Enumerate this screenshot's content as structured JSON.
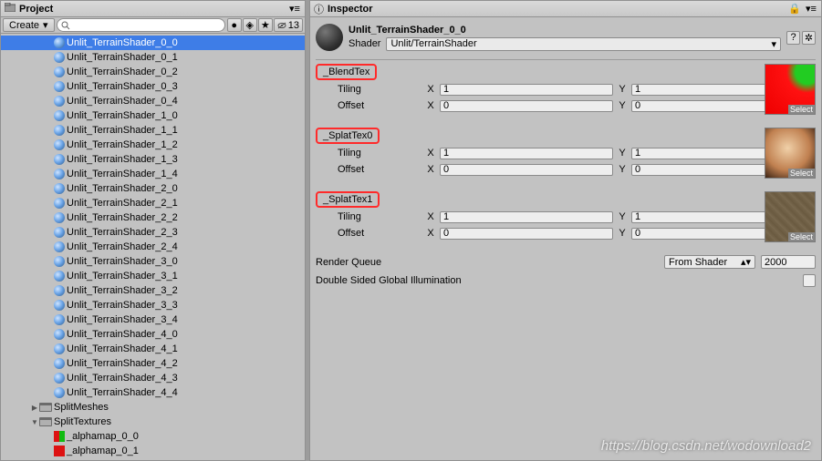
{
  "project": {
    "title": "Project",
    "create_label": "Create",
    "search_placeholder": "",
    "hidden_count": "13",
    "items": [
      {
        "type": "material",
        "name": "Unlit_TerrainShader_0_0",
        "depth": 3,
        "selected": true
      },
      {
        "type": "material",
        "name": "Unlit_TerrainShader_0_1",
        "depth": 3
      },
      {
        "type": "material",
        "name": "Unlit_TerrainShader_0_2",
        "depth": 3
      },
      {
        "type": "material",
        "name": "Unlit_TerrainShader_0_3",
        "depth": 3
      },
      {
        "type": "material",
        "name": "Unlit_TerrainShader_0_4",
        "depth": 3
      },
      {
        "type": "material",
        "name": "Unlit_TerrainShader_1_0",
        "depth": 3
      },
      {
        "type": "material",
        "name": "Unlit_TerrainShader_1_1",
        "depth": 3
      },
      {
        "type": "material",
        "name": "Unlit_TerrainShader_1_2",
        "depth": 3
      },
      {
        "type": "material",
        "name": "Unlit_TerrainShader_1_3",
        "depth": 3
      },
      {
        "type": "material",
        "name": "Unlit_TerrainShader_1_4",
        "depth": 3
      },
      {
        "type": "material",
        "name": "Unlit_TerrainShader_2_0",
        "depth": 3
      },
      {
        "type": "material",
        "name": "Unlit_TerrainShader_2_1",
        "depth": 3
      },
      {
        "type": "material",
        "name": "Unlit_TerrainShader_2_2",
        "depth": 3
      },
      {
        "type": "material",
        "name": "Unlit_TerrainShader_2_3",
        "depth": 3
      },
      {
        "type": "material",
        "name": "Unlit_TerrainShader_2_4",
        "depth": 3
      },
      {
        "type": "material",
        "name": "Unlit_TerrainShader_3_0",
        "depth": 3
      },
      {
        "type": "material",
        "name": "Unlit_TerrainShader_3_1",
        "depth": 3
      },
      {
        "type": "material",
        "name": "Unlit_TerrainShader_3_2",
        "depth": 3
      },
      {
        "type": "material",
        "name": "Unlit_TerrainShader_3_3",
        "depth": 3
      },
      {
        "type": "material",
        "name": "Unlit_TerrainShader_3_4",
        "depth": 3
      },
      {
        "type": "material",
        "name": "Unlit_TerrainShader_4_0",
        "depth": 3
      },
      {
        "type": "material",
        "name": "Unlit_TerrainShader_4_1",
        "depth": 3
      },
      {
        "type": "material",
        "name": "Unlit_TerrainShader_4_2",
        "depth": 3
      },
      {
        "type": "material",
        "name": "Unlit_TerrainShader_4_3",
        "depth": 3
      },
      {
        "type": "material",
        "name": "Unlit_TerrainShader_4_4",
        "depth": 3
      },
      {
        "type": "folder",
        "name": "SplitMeshes",
        "depth": 2,
        "tri": "▶"
      },
      {
        "type": "folder",
        "name": "SplitTextures",
        "depth": 2,
        "tri": "▼"
      },
      {
        "type": "texture",
        "name": "_alphamap_0_0",
        "depth": 3,
        "color": "linear-gradient(90deg,#d11 50%,#1b1 50%)"
      },
      {
        "type": "texture",
        "name": "_alphamap_0_1",
        "depth": 3,
        "color": "#d11"
      }
    ]
  },
  "inspector": {
    "title": "Inspector",
    "material_name": "Unlit_TerrainShader_0_0",
    "shader_label": "Shader",
    "shader_value": "Unlit/TerrainShader",
    "properties": [
      {
        "name": "_BlendTex",
        "highlight": true,
        "tiling_x": "1",
        "tiling_y": "1",
        "offset_x": "0",
        "offset_y": "0",
        "thumb": "blend"
      },
      {
        "name": "_SplatTex0",
        "highlight": true,
        "tiling_x": "1",
        "tiling_y": "1",
        "offset_x": "0",
        "offset_y": "0",
        "thumb": "photo"
      },
      {
        "name": "_SplatTex1",
        "highlight": true,
        "tiling_x": "1",
        "tiling_y": "1",
        "offset_x": "0",
        "offset_y": "0",
        "thumb": "dirt"
      }
    ],
    "tiling_label": "Tiling",
    "offset_label": "Offset",
    "x_label": "X",
    "y_label": "Y",
    "select_label": "Select",
    "render_queue_label": "Render Queue",
    "render_queue_mode": "From Shader",
    "render_queue_value": "2000",
    "dsgi_label": "Double Sided Global Illumination"
  },
  "watermark": "https://blog.csdn.net/wodownload2"
}
